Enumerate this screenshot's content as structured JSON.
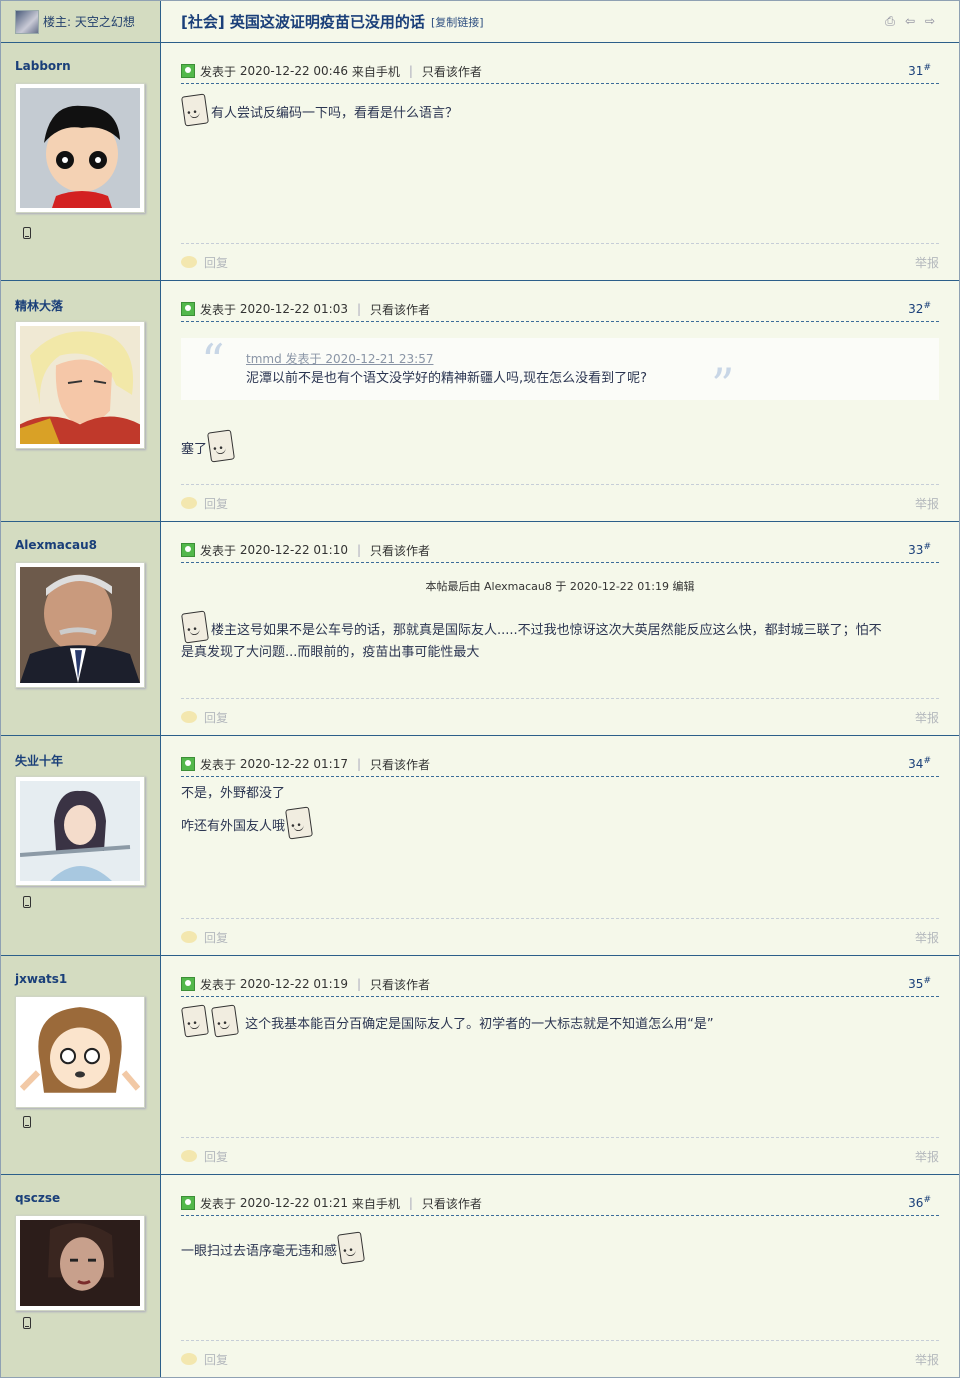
{
  "header": {
    "op_label": "楼主: 天空之幻想",
    "title": "[社会] 英国这波证明疫苗已没用的话",
    "copy_link": "[复制链接]"
  },
  "common": {
    "posted_prefix": "发表于",
    "only_author": "只看该作者",
    "reply": "回复",
    "report": "举报",
    "from_mobile": "来自手机"
  },
  "posts": [
    {
      "username": "Labborn",
      "time": "2020-12-22 00:46",
      "mobile": true,
      "floor": "31",
      "content": [
        "有人尝试反编码一下吗，看看是什么语言？"
      ]
    },
    {
      "username": "精林大落",
      "time": "2020-12-22 01:03",
      "mobile": false,
      "floor": "32",
      "quote_head": "tmmd 发表于 2020-12-21 23:57",
      "quote_body": "泥潭以前不是也有个语文没学好的精神新疆人吗,现在怎么没看到了呢?",
      "content": [
        "塞了"
      ]
    },
    {
      "username": "Alexmacau8",
      "time": "2020-12-22 01:10",
      "mobile": false,
      "floor": "33",
      "edit_note": "本帖最后由 Alexmacau8 于 2020-12-22 01:19 编辑",
      "content": [
        "楼主这号如果不是公车号的话，那就真是国际友人.....不过我也惊讶这次大英居然能反应这么快，都封城三联了；怕不",
        "是真发现了大问题...而眼前的，疫苗出事可能性最大"
      ]
    },
    {
      "username": "失业十年",
      "time": "2020-12-22 01:17",
      "mobile": false,
      "floor": "34",
      "content": [
        "不是，外野都没了",
        "咋还有外国友人哦"
      ]
    },
    {
      "username": "jxwats1",
      "time": "2020-12-22 01:19",
      "mobile": false,
      "floor": "35",
      "content": [
        "这个我基本能百分百确定是国际友人了。初学者的一大标志就是不知道怎么用“是”"
      ]
    },
    {
      "username": "qsczse",
      "time": "2020-12-22 01:21",
      "mobile": true,
      "floor": "36",
      "content": [
        "一眼扫过去语序毫无违和感"
      ]
    }
  ]
}
